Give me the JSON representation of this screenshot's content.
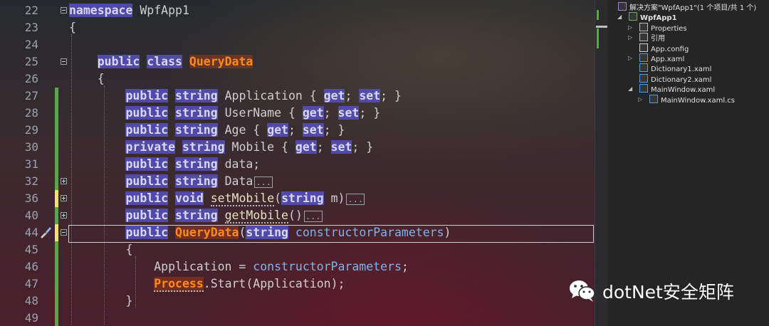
{
  "editor": {
    "lines": [
      {
        "n": "22",
        "tokens": [
          [
            "kw",
            "namespace"
          ],
          [
            "id",
            " WpfApp1"
          ]
        ]
      },
      {
        "n": "23",
        "tokens": [
          [
            "id",
            "{"
          ]
        ]
      },
      {
        "n": "24",
        "tokens": []
      },
      {
        "n": "25",
        "tokens": [
          [
            "id",
            "    "
          ],
          [
            "kw",
            "public"
          ],
          [
            "id",
            " "
          ],
          [
            "kw",
            "class"
          ],
          [
            "id",
            " "
          ],
          [
            "ty",
            "QueryData"
          ]
        ]
      },
      {
        "n": "26",
        "tokens": [
          [
            "id",
            "    {"
          ]
        ]
      },
      {
        "n": "27",
        "tokens": [
          [
            "id",
            "        "
          ],
          [
            "kw",
            "public"
          ],
          [
            "id",
            " "
          ],
          [
            "kw",
            "string"
          ],
          [
            "id",
            " Application { "
          ],
          [
            "kw",
            "get"
          ],
          [
            "id",
            "; "
          ],
          [
            "kw",
            "set"
          ],
          [
            "id",
            "; }"
          ]
        ]
      },
      {
        "n": "28",
        "tokens": [
          [
            "id",
            "        "
          ],
          [
            "kw",
            "public"
          ],
          [
            "id",
            " "
          ],
          [
            "kw",
            "string"
          ],
          [
            "id",
            " UserName { "
          ],
          [
            "kw",
            "get"
          ],
          [
            "id",
            "; "
          ],
          [
            "kw",
            "set"
          ],
          [
            "id",
            "; }"
          ]
        ]
      },
      {
        "n": "29",
        "tokens": [
          [
            "id",
            "        "
          ],
          [
            "kw",
            "public"
          ],
          [
            "id",
            " "
          ],
          [
            "kw",
            "string"
          ],
          [
            "id",
            " Age { "
          ],
          [
            "kw",
            "get"
          ],
          [
            "id",
            "; "
          ],
          [
            "kw",
            "set"
          ],
          [
            "id",
            "; }"
          ]
        ]
      },
      {
        "n": "30",
        "tokens": [
          [
            "id",
            "        "
          ],
          [
            "kw",
            "private"
          ],
          [
            "id",
            " "
          ],
          [
            "kw",
            "string"
          ],
          [
            "id",
            " Mobile { "
          ],
          [
            "kw",
            "get"
          ],
          [
            "id",
            "; "
          ],
          [
            "kw",
            "set"
          ],
          [
            "id",
            "; }"
          ]
        ]
      },
      {
        "n": "31",
        "tokens": [
          [
            "id",
            "        "
          ],
          [
            "kw",
            "public"
          ],
          [
            "id",
            " "
          ],
          [
            "kw",
            "string"
          ],
          [
            "id",
            " data;"
          ]
        ]
      },
      {
        "n": "32",
        "tokens": [
          [
            "id",
            "        "
          ],
          [
            "kw",
            "public"
          ],
          [
            "id",
            " "
          ],
          [
            "kw",
            "string"
          ],
          [
            "id",
            " Data"
          ],
          [
            "coll",
            "..."
          ]
        ]
      },
      {
        "n": "36",
        "tokens": [
          [
            "id",
            "        "
          ],
          [
            "kw",
            "public"
          ],
          [
            "id",
            " "
          ],
          [
            "kw",
            "void"
          ],
          [
            "id",
            " "
          ],
          [
            "mtd",
            "setMobile"
          ],
          [
            "id",
            "("
          ],
          [
            "kw",
            "string"
          ],
          [
            "id",
            " m)"
          ],
          [
            "coll",
            "..."
          ]
        ]
      },
      {
        "n": "40",
        "tokens": [
          [
            "id",
            "        "
          ],
          [
            "kw",
            "public"
          ],
          [
            "id",
            " "
          ],
          [
            "kw",
            "string"
          ],
          [
            "id",
            " "
          ],
          [
            "mtd",
            "getMobile"
          ],
          [
            "id",
            "()"
          ],
          [
            "coll",
            "..."
          ]
        ]
      },
      {
        "n": "44",
        "tokens": [
          [
            "id",
            "        "
          ],
          [
            "kw",
            "public"
          ],
          [
            "id",
            " "
          ],
          [
            "ty",
            "QueryData"
          ],
          [
            "id",
            "("
          ],
          [
            "kw",
            "string"
          ],
          [
            "id",
            " "
          ],
          [
            "pm",
            "constructorParameters"
          ],
          [
            "id",
            ")"
          ]
        ]
      },
      {
        "n": "45",
        "tokens": [
          [
            "id",
            "        {"
          ]
        ]
      },
      {
        "n": "46",
        "tokens": [
          [
            "id",
            "            Application = "
          ],
          [
            "pm",
            "constructorParameters"
          ],
          [
            "id",
            ";"
          ]
        ]
      },
      {
        "n": "47",
        "tokens": [
          [
            "id",
            "            "
          ],
          [
            "tyd",
            "Process"
          ],
          [
            "id",
            ".Start(Application);"
          ]
        ]
      },
      {
        "n": "48",
        "tokens": [
          [
            "id",
            "        }"
          ]
        ]
      },
      {
        "n": "49",
        "tokens": []
      }
    ]
  },
  "solution_explorer": {
    "items": [
      {
        "label": "解决方案\"WpfApp1\"(1 个项目/共 1 个)",
        "icon": "solution-icon",
        "level": 0,
        "arrow": ""
      },
      {
        "label": "WpfApp1",
        "icon": "csharp-project-icon",
        "level": 1,
        "arrow": "◢",
        "bold": true
      },
      {
        "label": "Properties",
        "icon": "wrench-icon",
        "level": 2,
        "arrow": "▷"
      },
      {
        "label": "引用",
        "icon": "references-icon",
        "level": 2,
        "arrow": "▷"
      },
      {
        "label": "App.config",
        "icon": "config-file-icon",
        "level": 2,
        "arrow": ""
      },
      {
        "label": "App.xaml",
        "icon": "xaml-file-icon",
        "level": 2,
        "arrow": "▷"
      },
      {
        "label": "Dictionary1.xaml",
        "icon": "xaml-file-icon",
        "level": 2,
        "arrow": ""
      },
      {
        "label": "Dictionary2.xaml",
        "icon": "xaml-file-icon",
        "level": 2,
        "arrow": ""
      },
      {
        "label": "MainWindow.xaml",
        "icon": "xaml-file-icon",
        "level": 2,
        "arrow": "◢"
      },
      {
        "label": "MainWindow.xaml.cs",
        "icon": "csharp-file-icon",
        "level": 3,
        "arrow": "▷"
      }
    ]
  },
  "watermark": {
    "text": "dotNet安全矩阵",
    "icon": "wechat-icon"
  },
  "colors": {
    "keyword_bg": "#5650be",
    "type": "#ff8a1a",
    "param": "#7fb3ea",
    "change_green": "#57a64a",
    "change_yellow": "#efe36b"
  }
}
